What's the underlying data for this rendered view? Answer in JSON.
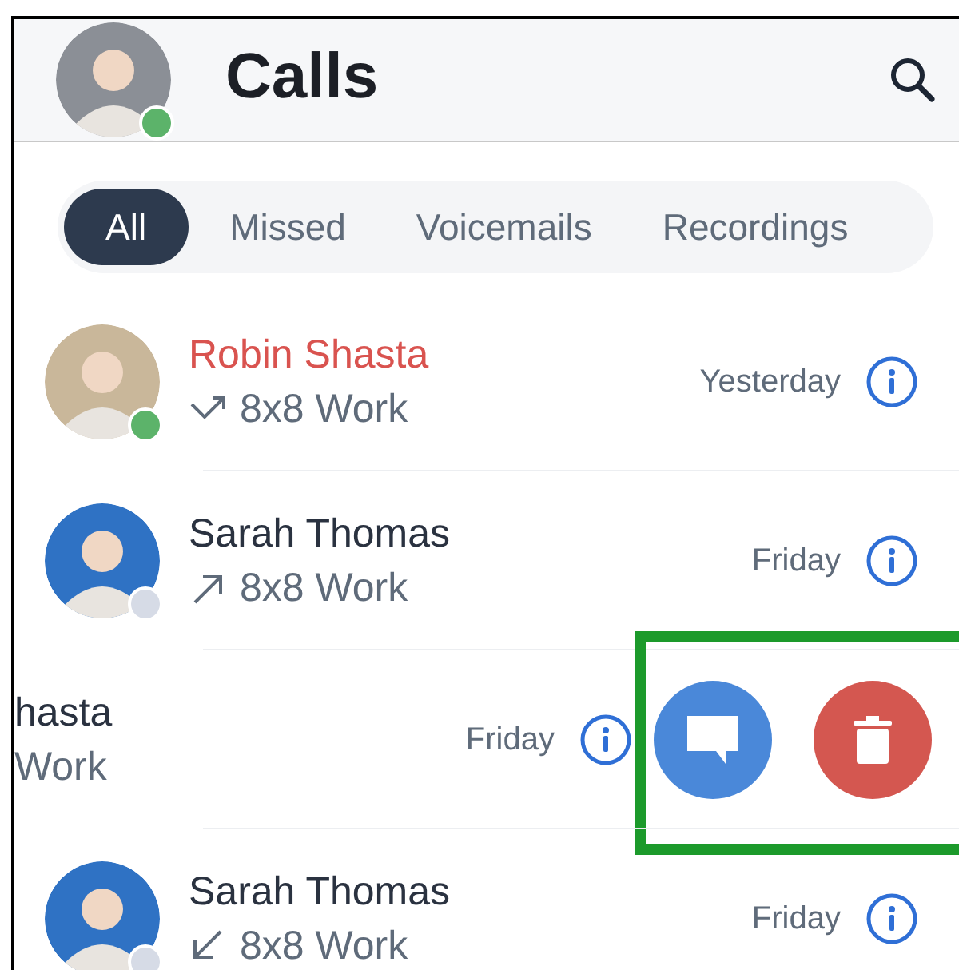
{
  "header": {
    "title": "Calls",
    "user_online": true
  },
  "tabs": [
    {
      "label": "All",
      "selected": true
    },
    {
      "label": "Missed",
      "selected": false
    },
    {
      "label": "Voicemails",
      "selected": false
    },
    {
      "label": "Recordings",
      "selected": false
    }
  ],
  "calls": [
    {
      "name": "Robin Shasta",
      "missed": true,
      "line": "8x8 Work",
      "when": "Yesterday",
      "online": true,
      "swiped": false
    },
    {
      "name": "Sarah Thomas",
      "missed": false,
      "outgoing": true,
      "line": "8x8 Work",
      "when": "Friday",
      "online": false,
      "swiped": false
    },
    {
      "name": "hasta",
      "missed": false,
      "line": "Work",
      "when": "Friday",
      "swiped": true,
      "highlighted": true
    },
    {
      "name": "Sarah Thomas",
      "missed": false,
      "outgoing": false,
      "line": "8x8 Work",
      "when": "Friday",
      "online": false,
      "swiped": false
    }
  ]
}
